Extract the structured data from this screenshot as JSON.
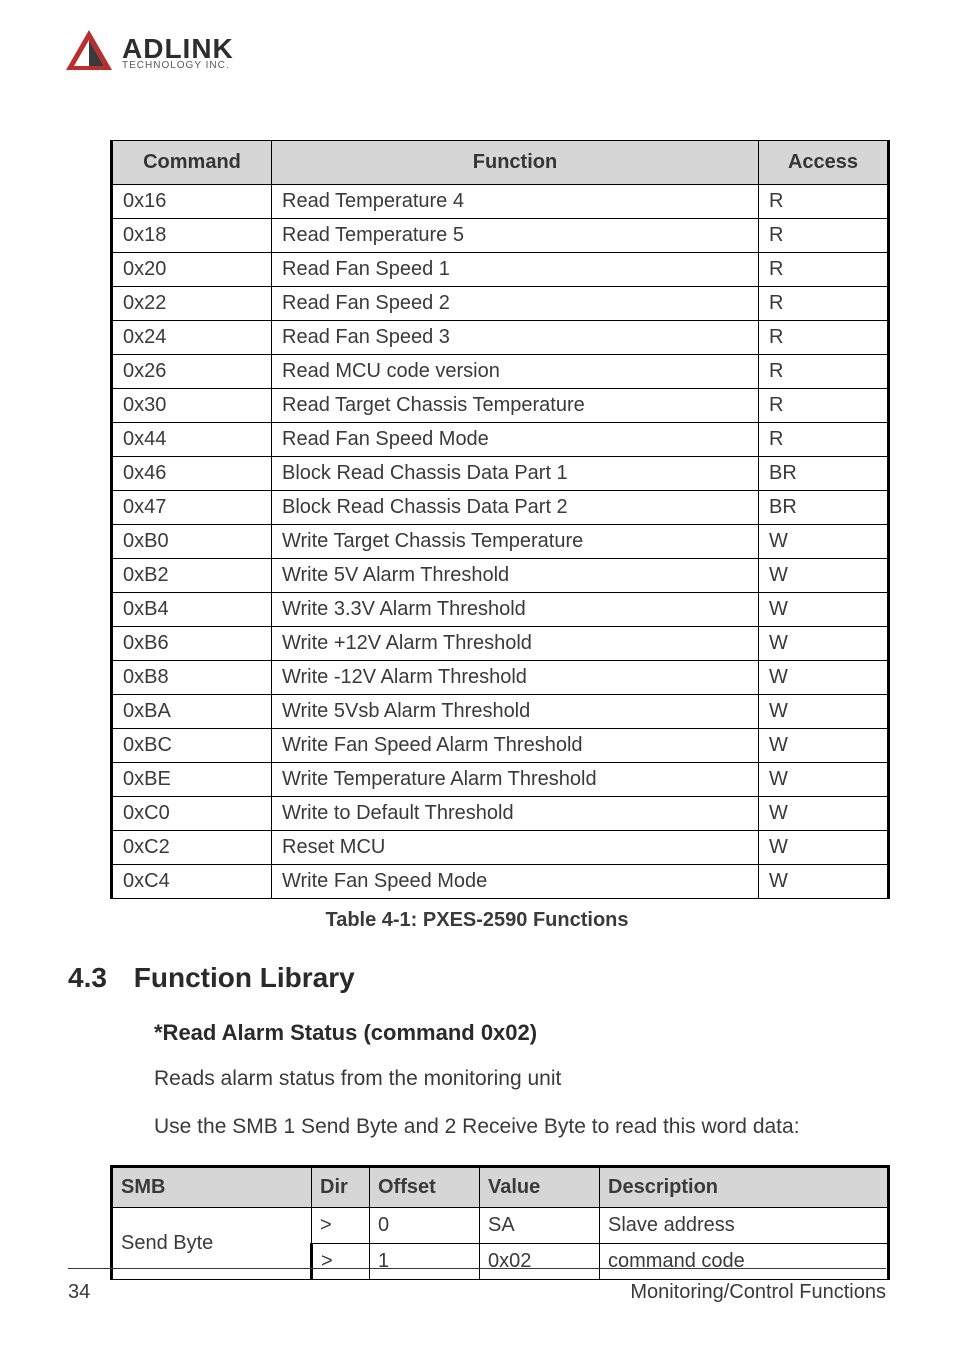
{
  "logo": {
    "name": "ADLINK",
    "sub": "TECHNOLOGY INC."
  },
  "table1": {
    "headers": {
      "command": "Command",
      "function": "Function",
      "access": "Access"
    },
    "rows": [
      {
        "cmd": "0x16",
        "fn": "Read Temperature 4",
        "acc": "R"
      },
      {
        "cmd": "0x18",
        "fn": "Read Temperature 5",
        "acc": "R"
      },
      {
        "cmd": "0x20",
        "fn": "Read Fan Speed 1",
        "acc": "R"
      },
      {
        "cmd": "0x22",
        "fn": "Read Fan Speed 2",
        "acc": "R"
      },
      {
        "cmd": "0x24",
        "fn": "Read Fan Speed 3",
        "acc": "R"
      },
      {
        "cmd": "0x26",
        "fn": "Read MCU code version",
        "acc": "R"
      },
      {
        "cmd": "0x30",
        "fn": "Read Target Chassis Temperature",
        "acc": "R"
      },
      {
        "cmd": "0x44",
        "fn": "Read Fan Speed Mode",
        "acc": "R"
      },
      {
        "cmd": "0x46",
        "fn": "Block Read Chassis Data Part 1",
        "acc": "BR"
      },
      {
        "cmd": "0x47",
        "fn": "Block Read Chassis Data Part 2",
        "acc": "BR"
      },
      {
        "cmd": "0xB0",
        "fn": "Write Target Chassis Temperature",
        "acc": "W"
      },
      {
        "cmd": "0xB2",
        "fn": "Write 5V Alarm Threshold",
        "acc": "W"
      },
      {
        "cmd": "0xB4",
        "fn": "Write 3.3V Alarm Threshold",
        "acc": "W"
      },
      {
        "cmd": "0xB6",
        "fn": "Write +12V Alarm Threshold",
        "acc": "W"
      },
      {
        "cmd": "0xB8",
        "fn": "Write -12V Alarm Threshold",
        "acc": "W"
      },
      {
        "cmd": "0xBA",
        "fn": "Write 5Vsb Alarm Threshold",
        "acc": "W"
      },
      {
        "cmd": "0xBC",
        "fn": "Write Fan Speed Alarm Threshold",
        "acc": "W"
      },
      {
        "cmd": "0xBE",
        "fn": "Write Temperature Alarm Threshold",
        "acc": "W"
      },
      {
        "cmd": "0xC0",
        "fn": "Write to Default Threshold",
        "acc": "W"
      },
      {
        "cmd": "0xC2",
        "fn": "Reset MCU",
        "acc": "W"
      },
      {
        "cmd": "0xC4",
        "fn": "Write Fan Speed Mode",
        "acc": "W"
      }
    ],
    "caption": "Table  4-1: PXES-2590 Functions"
  },
  "section": {
    "num": "4.3",
    "title": "Function Library",
    "sub": "*Read Alarm Status (command 0x02)",
    "p1": "Reads alarm status from the monitoring unit",
    "p2": "Use the SMB 1 Send Byte and 2 Receive Byte to read this word data:"
  },
  "table2": {
    "headers": {
      "smb": "SMB",
      "dir": "Dir",
      "offset": "Offset",
      "value": "Value",
      "desc": "Description"
    },
    "rows": [
      {
        "smb": "Send Byte",
        "dir": ">",
        "off": "0",
        "val": "SA",
        "desc": "Slave address"
      },
      {
        "smb": "",
        "dir": ">",
        "off": "1",
        "val": "0x02",
        "desc": "command code"
      }
    ]
  },
  "footer": {
    "page": "34",
    "title": "Monitoring/Control Functions"
  }
}
